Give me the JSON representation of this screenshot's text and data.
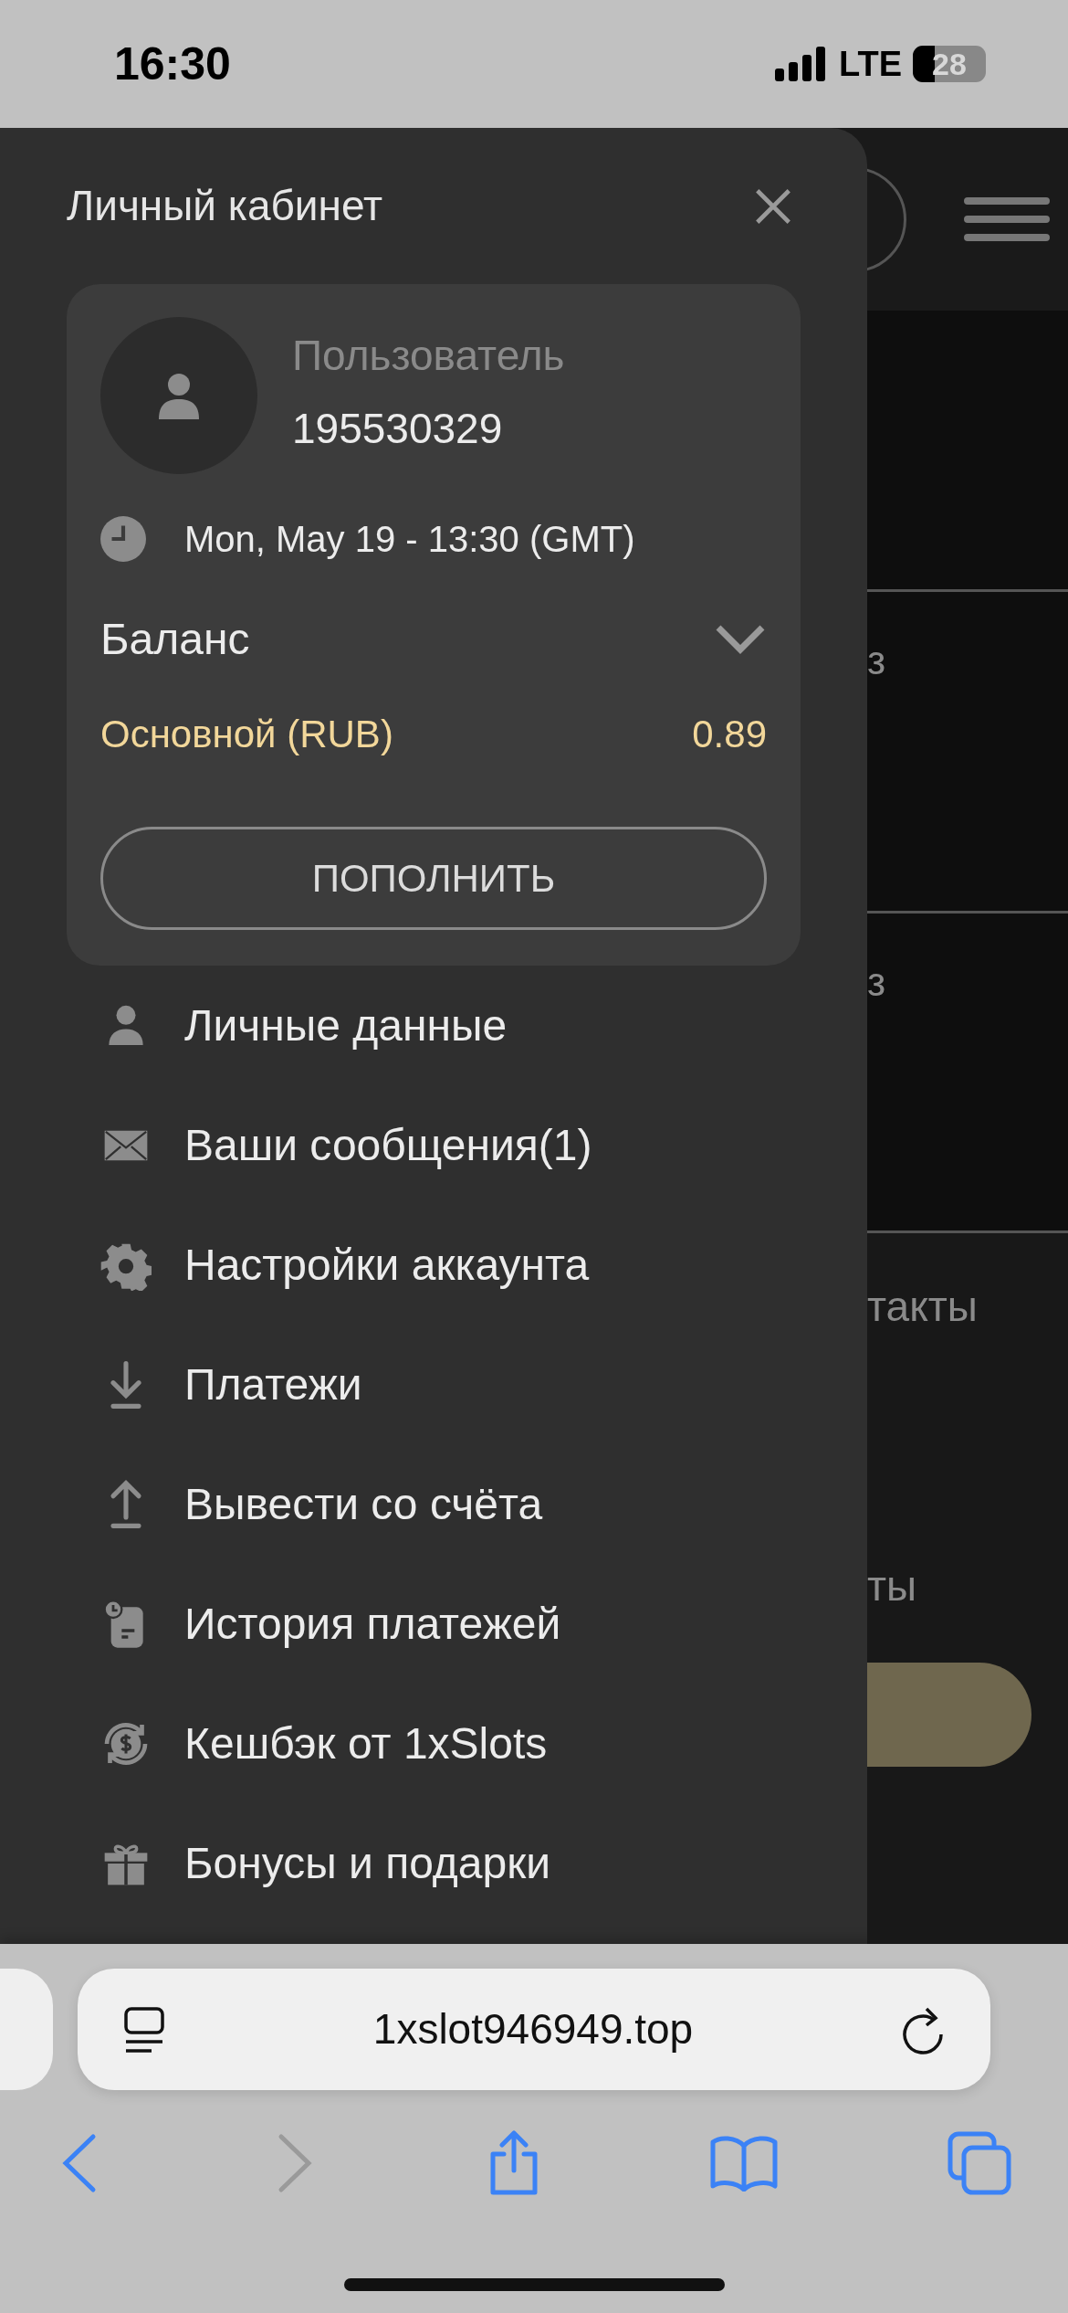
{
  "status_bar": {
    "time": "16:30",
    "network": "LTE",
    "battery": "28"
  },
  "drawer": {
    "title": "Личный кабинет",
    "profile": {
      "role": "Пользователь",
      "user_id": "195530329",
      "datetime": "Mon, May 19 - 13:30 (GMT)",
      "balance_label": "Баланс",
      "balance_expanded": false,
      "account": {
        "name": "Основной (RUB)",
        "amount": "0.89"
      },
      "deposit_button": "ПОПОЛНИТЬ"
    },
    "menu": [
      {
        "label": "Личные данные"
      },
      {
        "label": "Ваши сообщения(1)"
      },
      {
        "label": "Настройки аккаунта"
      },
      {
        "label": "Платежи"
      },
      {
        "label": "Вывести со счёта"
      },
      {
        "label": "История платежей"
      },
      {
        "label": "Кешбэк от 1xSlots"
      },
      {
        "label": "Бонусы и подарки"
      }
    ]
  },
  "background_page": {
    "texts": [
      "з",
      "з",
      "такты",
      "ты"
    ]
  },
  "browser": {
    "url": "1xslot946949.top"
  }
}
